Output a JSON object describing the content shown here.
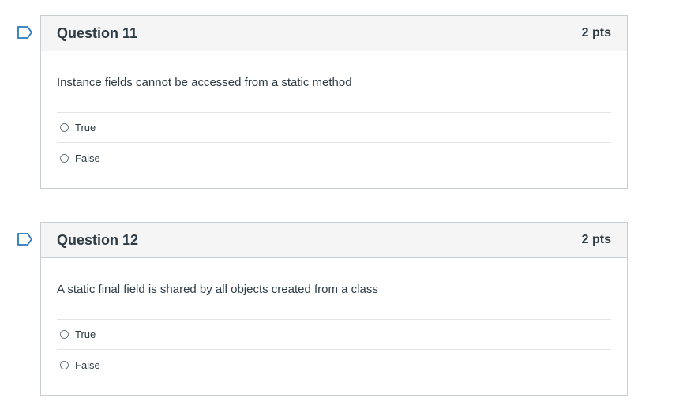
{
  "questions": [
    {
      "title": "Question 11",
      "points": "2 pts",
      "text": "Instance fields cannot be accessed from a static method",
      "answers": [
        "True",
        "False"
      ],
      "flag_icon": "bookmark-flag-icon"
    },
    {
      "title": "Question 12",
      "points": "2 pts",
      "text": "A static final field is shared by all objects created from a class",
      "answers": [
        "True",
        "False"
      ],
      "flag_icon": "bookmark-flag-icon"
    }
  ],
  "colors": {
    "flag": "#2b7abc",
    "header_bg": "#f5f5f5",
    "border": "#c7cdd1",
    "text": "#2d3b45"
  }
}
